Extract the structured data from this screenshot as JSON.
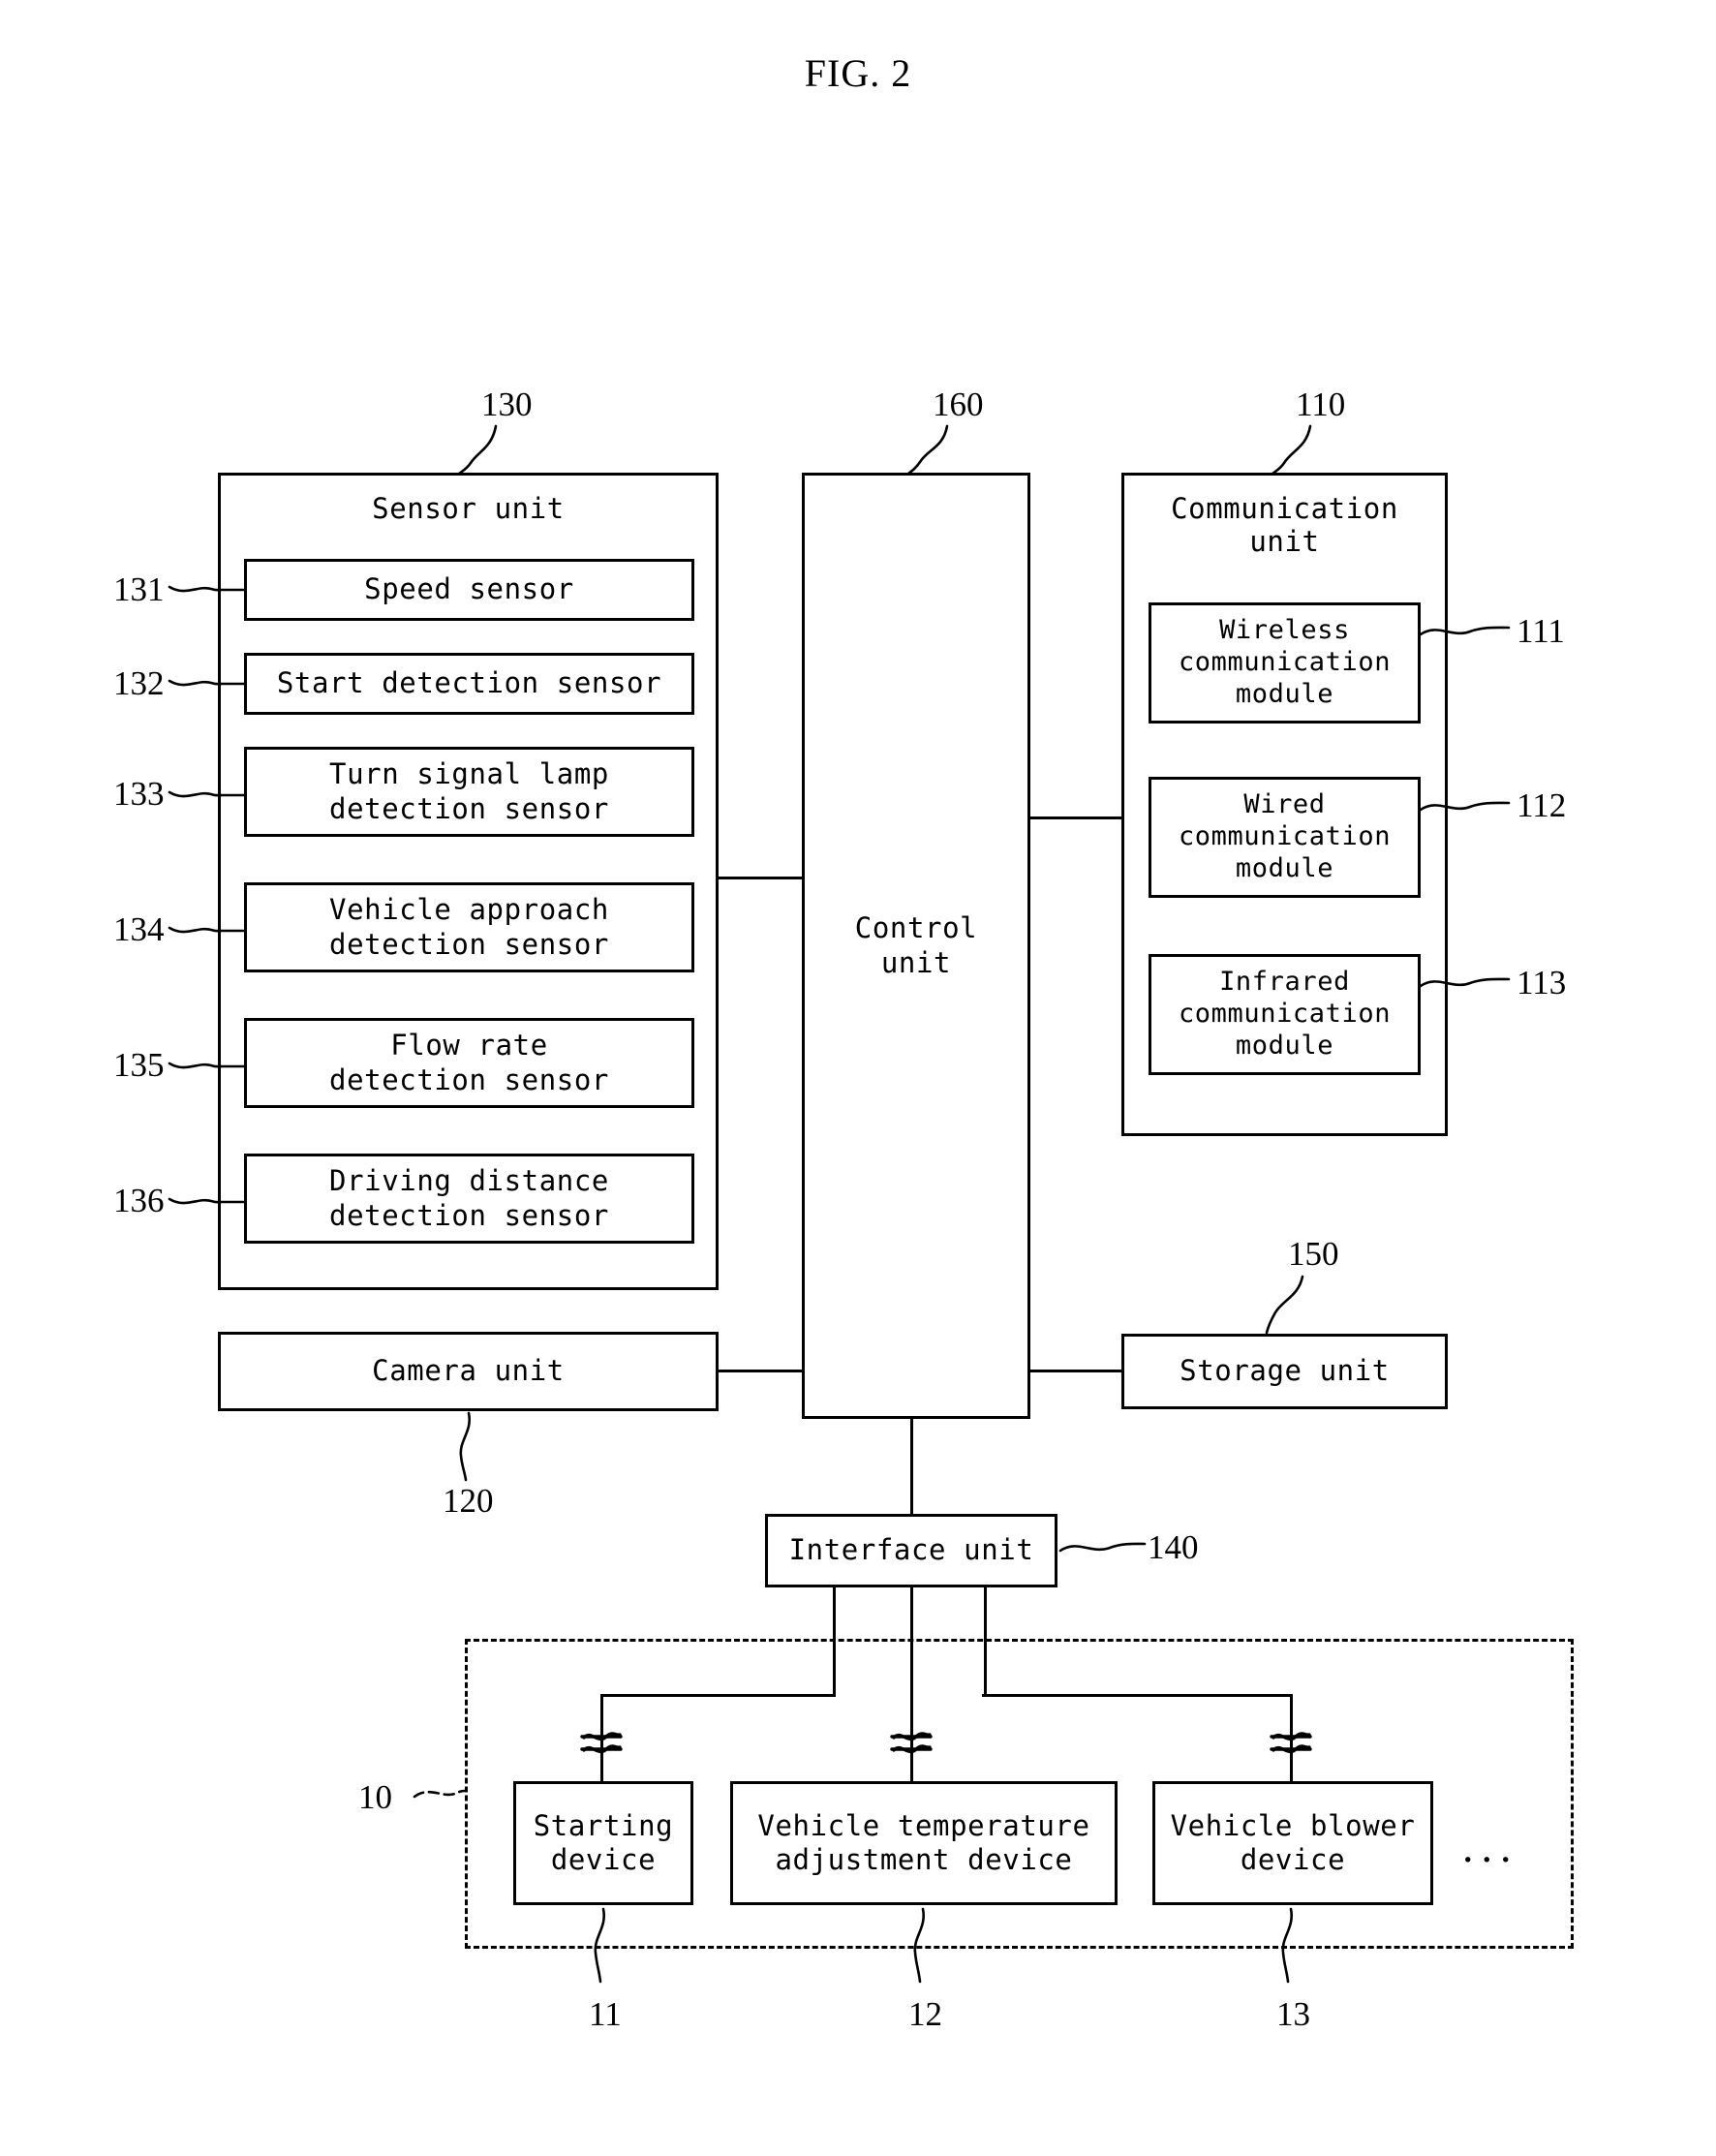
{
  "figure": {
    "title": "FIG. 2"
  },
  "sensor_unit": {
    "ref": "130",
    "title": "Sensor unit",
    "sensors": [
      {
        "ref": "131",
        "label": "Speed sensor"
      },
      {
        "ref": "132",
        "label": "Start detection sensor"
      },
      {
        "ref": "133",
        "label": "Turn signal lamp\ndetection sensor"
      },
      {
        "ref": "134",
        "label": "Vehicle approach\ndetection sensor"
      },
      {
        "ref": "135",
        "label": "Flow rate\ndetection sensor"
      },
      {
        "ref": "136",
        "label": "Driving distance\ndetection sensor"
      }
    ]
  },
  "control_unit": {
    "ref": "160",
    "label": "Control\nunit"
  },
  "communication_unit": {
    "ref": "110",
    "title": "Communication\nunit",
    "modules": [
      {
        "ref": "111",
        "label": "Wireless\ncommunication\nmodule"
      },
      {
        "ref": "112",
        "label": "Wired\ncommunication\nmodule"
      },
      {
        "ref": "113",
        "label": "Infrared\ncommunication\nmodule"
      }
    ]
  },
  "camera_unit": {
    "ref": "120",
    "label": "Camera unit"
  },
  "storage_unit": {
    "ref": "150",
    "label": "Storage unit"
  },
  "interface_unit": {
    "ref": "140",
    "label": "Interface unit"
  },
  "external_system": {
    "ref": "10",
    "ellipsis": "...",
    "devices": [
      {
        "ref": "11",
        "label": "Starting\ndevice"
      },
      {
        "ref": "12",
        "label": "Vehicle temperature\nadjustment device"
      },
      {
        "ref": "13",
        "label": "Vehicle blower\ndevice"
      }
    ]
  }
}
